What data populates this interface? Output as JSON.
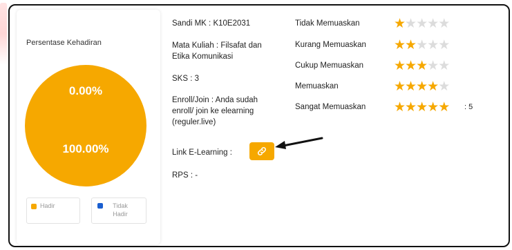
{
  "attendance": {
    "title": "Persentase Kehadiran",
    "top_label": "0.00%",
    "bottom_label": "100.00%",
    "legend": [
      {
        "label": "Hadir",
        "color": "#f6a800"
      },
      {
        "label": "Tidak Hadir",
        "color": "#1a5fd0"
      }
    ],
    "chart_color": "#f6a800"
  },
  "course": {
    "code": "Sandi MK : K10E2031",
    "name_line1": "Mata Kuliah : Filsafat dan",
    "name_line2": "Etika Komunikasi",
    "sks": "SKS : 3",
    "enroll_line1": "Enroll/Join : Anda sudah",
    "enroll_line2": "enroll/ join ke elearning",
    "enroll_line3": "(reguler.live)",
    "link_label": "Link E-Learning :",
    "link_icon": "link-icon",
    "rps": "RPS : -"
  },
  "ratings": {
    "items": [
      {
        "label": "Tidak Memuaskan",
        "stars": 1
      },
      {
        "label": "Kurang Memuaskan",
        "stars": 2
      },
      {
        "label": "Cukup Memuaskan",
        "stars": 3
      },
      {
        "label": "Memuaskan",
        "stars": 4
      },
      {
        "label": "Sangat Memuaskan",
        "stars": 5
      }
    ],
    "max_stars": 5,
    "selected_value": ": 5",
    "star_color": "#f6a800"
  }
}
